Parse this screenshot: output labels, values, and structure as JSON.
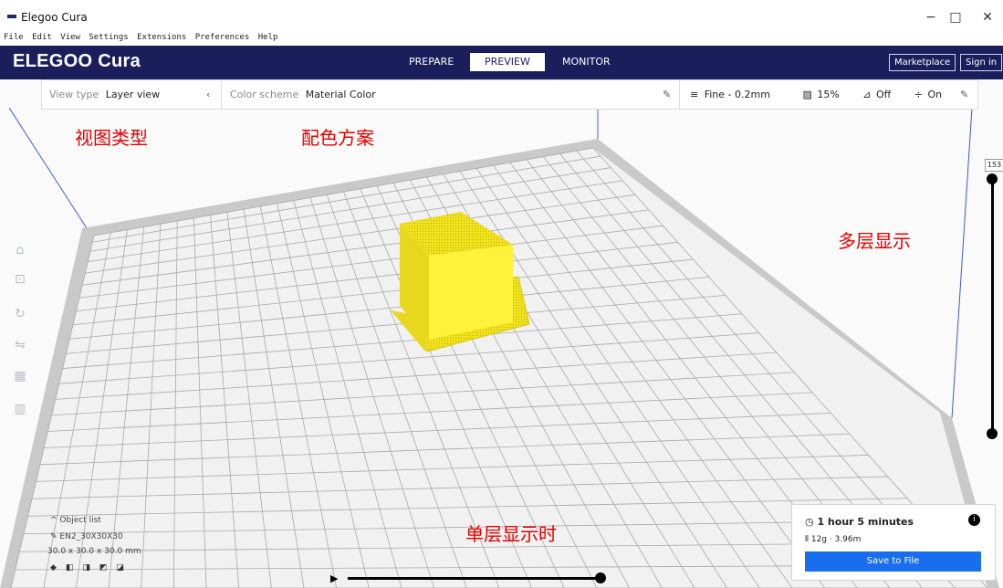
{
  "window": {
    "title": "Elegoo Cura",
    "minimize": "−",
    "maximize": "□",
    "close": "✕"
  },
  "menu": [
    "File",
    "Edit",
    "View",
    "Settings",
    "Extensions",
    "Preferences",
    "Help"
  ],
  "header": {
    "logo": "ELEGOO Cura",
    "tabs": [
      {
        "label": "PREPARE"
      },
      {
        "label": "PREVIEW",
        "active": true
      },
      {
        "label": "MONITOR"
      }
    ],
    "marketplace": "Marketplace",
    "signin": "Sign in"
  },
  "toolbar": {
    "view_type_label": "View type",
    "view_type_value": "Layer view",
    "color_scheme_label": "Color scheme",
    "color_scheme_value": "Material Color",
    "quality": "Fine - 0.2mm",
    "infill": "15%",
    "support": "Off",
    "adhesion": "On"
  },
  "annotations": {
    "view_type": "视图类型",
    "color_scheme": "配色方案",
    "multi_layer": "多层显示",
    "single_layer": "单层显示时"
  },
  "layer_slider": {
    "top_value": "153"
  },
  "object_panel": {
    "list_label": "Object list",
    "name": "EN2_30X30X30",
    "dimensions": "30.0 x 30.0 x 30.0 mm"
  },
  "print_info": {
    "time": "1 hour 5 minutes",
    "material": "12g · 3.96m",
    "save": "Save to File"
  },
  "colors": {
    "header": "#1a1f5c",
    "accent": "#196ef0",
    "model": "#f5e62a",
    "annotation": "#e60000"
  },
  "icons": [
    "move-icon",
    "scale-icon",
    "rotate-icon",
    "mirror-icon",
    "per-model-settings-icon",
    "support-blocker-icon",
    "info-icon",
    "clock-icon",
    "spool-icon",
    "pencil-icon",
    "play-icon"
  ]
}
